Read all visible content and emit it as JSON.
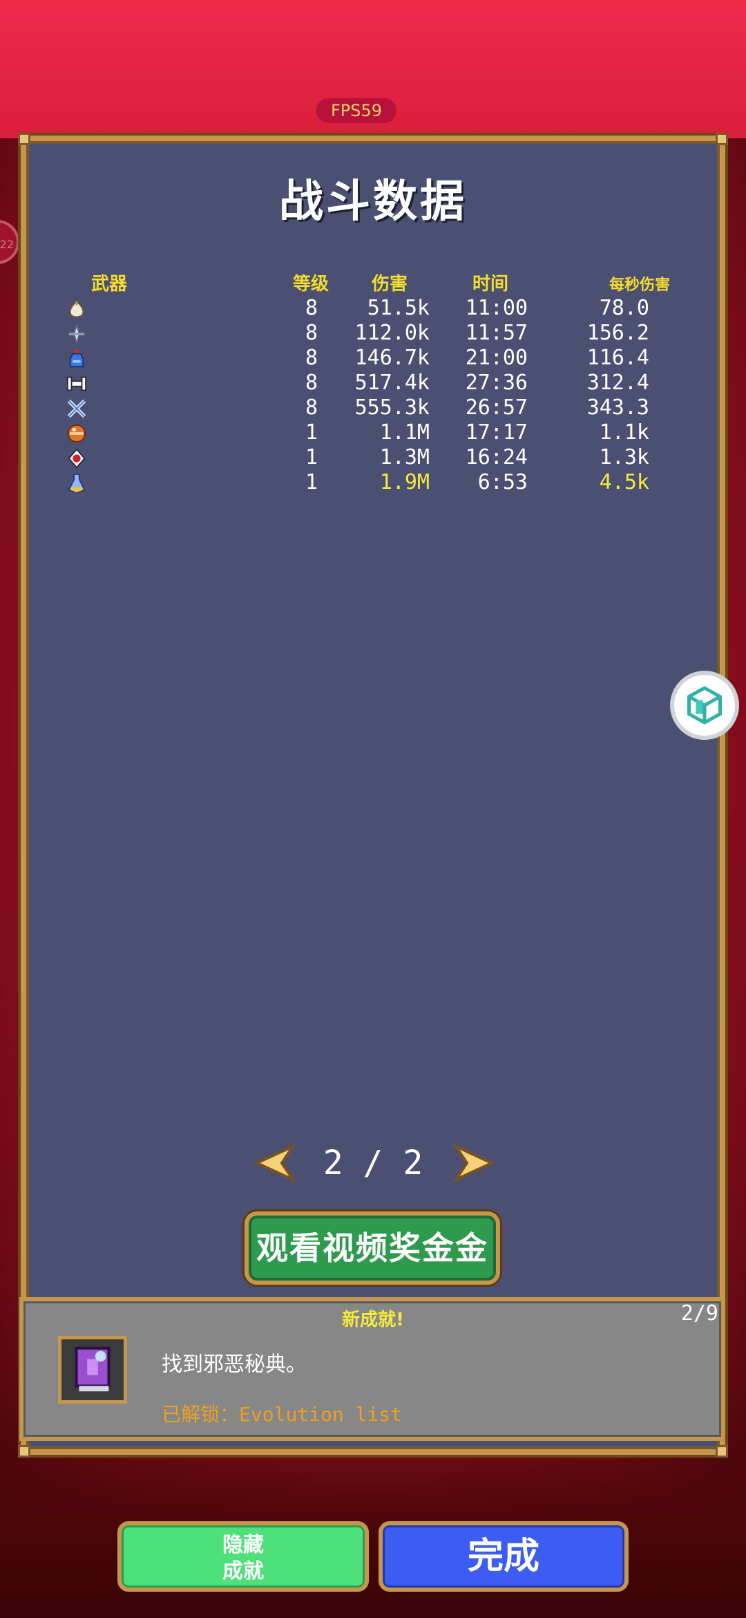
{
  "hud": {
    "fps": "FPS59",
    "edge_badge": "22"
  },
  "panel": {
    "title": "战斗数据"
  },
  "table": {
    "headers": {
      "weapon": "武器",
      "level": "等级",
      "damage": "伤害",
      "time": "时间",
      "dps": "每秒伤害"
    },
    "rows": [
      {
        "icon": "garlic-icon",
        "level": "8",
        "damage": "51.5k",
        "time": "11:00",
        "dps": "78.0",
        "highlight_damage": false,
        "highlight_dps": false
      },
      {
        "icon": "knife-icon",
        "level": "8",
        "damage": "112.0k",
        "time": "11:57",
        "dps": "156.2",
        "highlight_damage": false,
        "highlight_dps": false
      },
      {
        "icon": "holy-water-icon",
        "level": "8",
        "damage": "146.7k",
        "time": "21:00",
        "dps": "116.4",
        "highlight_damage": false,
        "highlight_dps": false
      },
      {
        "icon": "bone-icon",
        "level": "8",
        "damage": "517.4k",
        "time": "27:36",
        "dps": "312.4",
        "highlight_damage": false,
        "highlight_dps": false
      },
      {
        "icon": "cross-icon",
        "level": "8",
        "damage": "555.3k",
        "time": "26:57",
        "dps": "343.3",
        "highlight_damage": false,
        "highlight_dps": false
      },
      {
        "icon": "orb-icon",
        "level": "1",
        "damage": "1.1M",
        "time": "17:17",
        "dps": "1.1k",
        "highlight_damage": false,
        "highlight_dps": false
      },
      {
        "icon": "rose-icon",
        "level": "1",
        "damage": "1.3M",
        "time": "16:24",
        "dps": "1.3k",
        "highlight_damage": false,
        "highlight_dps": false
      },
      {
        "icon": "flask-icon",
        "level": "1",
        "damage": "1.9M",
        "time": "6:53",
        "dps": "4.5k",
        "highlight_damage": true,
        "highlight_dps": true
      }
    ]
  },
  "pager": {
    "text": "2 / 2"
  },
  "video_button": {
    "label": "观看视频奖金金"
  },
  "achievement": {
    "heading": "新成就!",
    "count": "2/9",
    "description": "找到邪恶秘典。",
    "unlock_prefix": "已解锁：",
    "unlock_name": "Evolution list",
    "icon": "grimoire-icon"
  },
  "buttons": {
    "hide_line1": "隐藏",
    "hide_line2": "成就",
    "done": "完成"
  },
  "colors": {
    "panel_bg": "#4b4f72",
    "gold_border": "#c7964d",
    "header_yellow": "#f3de2c",
    "accent_orange": "#f0a020"
  }
}
